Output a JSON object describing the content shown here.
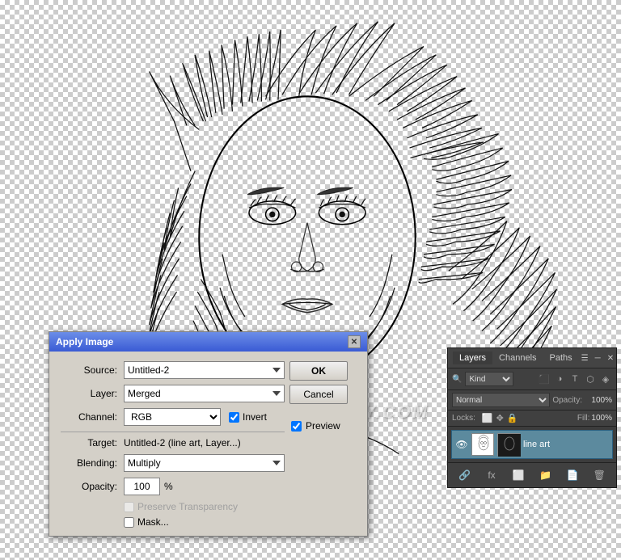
{
  "canvas": {
    "background": "checkerboard"
  },
  "watermark": {
    "text": "PHOTOSHOPSUPPLY.COM"
  },
  "dialog": {
    "title": "Apply Image",
    "source_label": "Source:",
    "source_value": "Untitled-2",
    "layer_label": "Layer:",
    "layer_value": "Merged",
    "channel_label": "Channel:",
    "channel_value": "RGB",
    "invert_label": "Invert",
    "invert_checked": true,
    "target_label": "Target:",
    "target_value": "Untitled-2 (line art, Layer...)",
    "blending_label": "Blending:",
    "blending_value": "Multiply",
    "opacity_label": "Opacity:",
    "opacity_value": "100",
    "opacity_unit": "%",
    "preserve_label": "Preserve Transparency",
    "preserve_checked": false,
    "preserve_disabled": true,
    "mask_label": "Mask...",
    "mask_checked": false,
    "ok_label": "OK",
    "cancel_label": "Cancel",
    "preview_label": "Preview",
    "preview_checked": true
  },
  "layers_panel": {
    "title": "Layers",
    "tabs": [
      "Layers",
      "Channels",
      "Paths"
    ],
    "active_tab": "Layers",
    "filter_label": "Kind",
    "filter_icons": [
      "pixel-icon",
      "adjust-icon",
      "text-icon",
      "shape-icon",
      "smart-icon"
    ],
    "blend_mode": "Normal",
    "opacity_label": "Opacity:",
    "opacity_value": "100%",
    "locks_label": "Locks:",
    "lock_icons": [
      "lock-pixel",
      "lock-pos",
      "lock-all"
    ],
    "fill_label": "Fill:",
    "fill_value": "100%",
    "layers": [
      {
        "name": "line art",
        "visible": true,
        "has_mask": true
      }
    ],
    "footer_buttons": [
      "link-icon",
      "fx-icon",
      "mask-icon",
      "group-icon",
      "new-layer-icon",
      "delete-icon"
    ]
  }
}
